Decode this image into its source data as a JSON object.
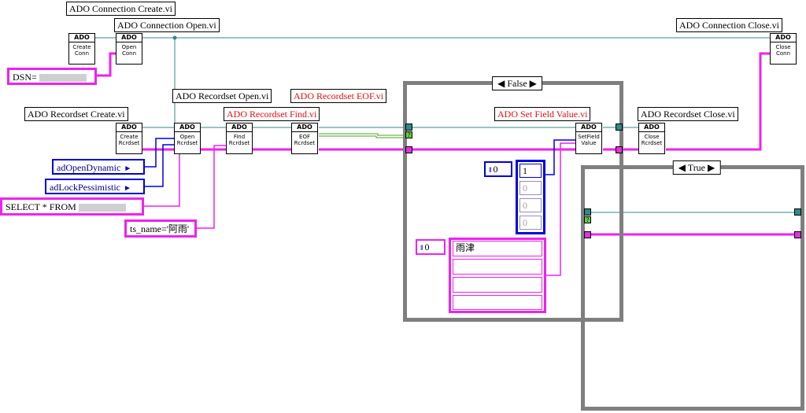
{
  "labels": {
    "conn_create": "ADO Connection Create.vi",
    "conn_open": "ADO Connection Open.vi",
    "conn_close": "ADO Connection Close.vi",
    "rs_create": "ADO Recordset Create.vi",
    "rs_open": "ADO Recordset Open.vi",
    "rs_find": "ADO Recordset Find.vi",
    "rs_eof": "ADO Recordset EOF.vi",
    "set_field": "ADO Set Field Value.vi",
    "rs_close": "ADO Recordset Close.vi"
  },
  "nodes": {
    "create_conn": {
      "head": "ADO",
      "body": "Create Conn"
    },
    "open_conn": {
      "head": "ADO",
      "body": "Open Conn"
    },
    "close_conn": {
      "head": "ADO",
      "body": "Close Conn"
    },
    "create_rs": {
      "head": "ADO",
      "body": "Create Rcrdset"
    },
    "open_rs": {
      "head": "ADO",
      "body": "Open Rcrdset"
    },
    "find_rs": {
      "head": "ADO",
      "body": "Find Rcrdset"
    },
    "eof_rs": {
      "head": "ADO",
      "body": "EOF Rcrdset"
    },
    "set_field": {
      "head": "ADO",
      "body": "SetField Value"
    },
    "close_rs": {
      "head": "ADO",
      "body": "Close Rcrdset"
    }
  },
  "constants": {
    "dsn": "DSN=",
    "open_dynamic": "adOpenDynamic",
    "lock_pessimistic": "adLockPessimistic",
    "sql": "SELECT * FROM",
    "find_criteria": "ts_name='阿雨'"
  },
  "case_false": {
    "selector": "False"
  },
  "case_true": {
    "selector": "True"
  },
  "bool_array": {
    "index": "0",
    "values": [
      "1",
      "0",
      "0",
      "0"
    ]
  },
  "str_array": {
    "index": "0",
    "values": [
      "雨津",
      "",
      ""
    ]
  },
  "colors": {
    "refnum_wire": "#338888",
    "string_wire": "#ee22ee",
    "enum_wire": "#0000dd",
    "bool_wire": "#44aa22",
    "frame": "#7f7f7f"
  }
}
